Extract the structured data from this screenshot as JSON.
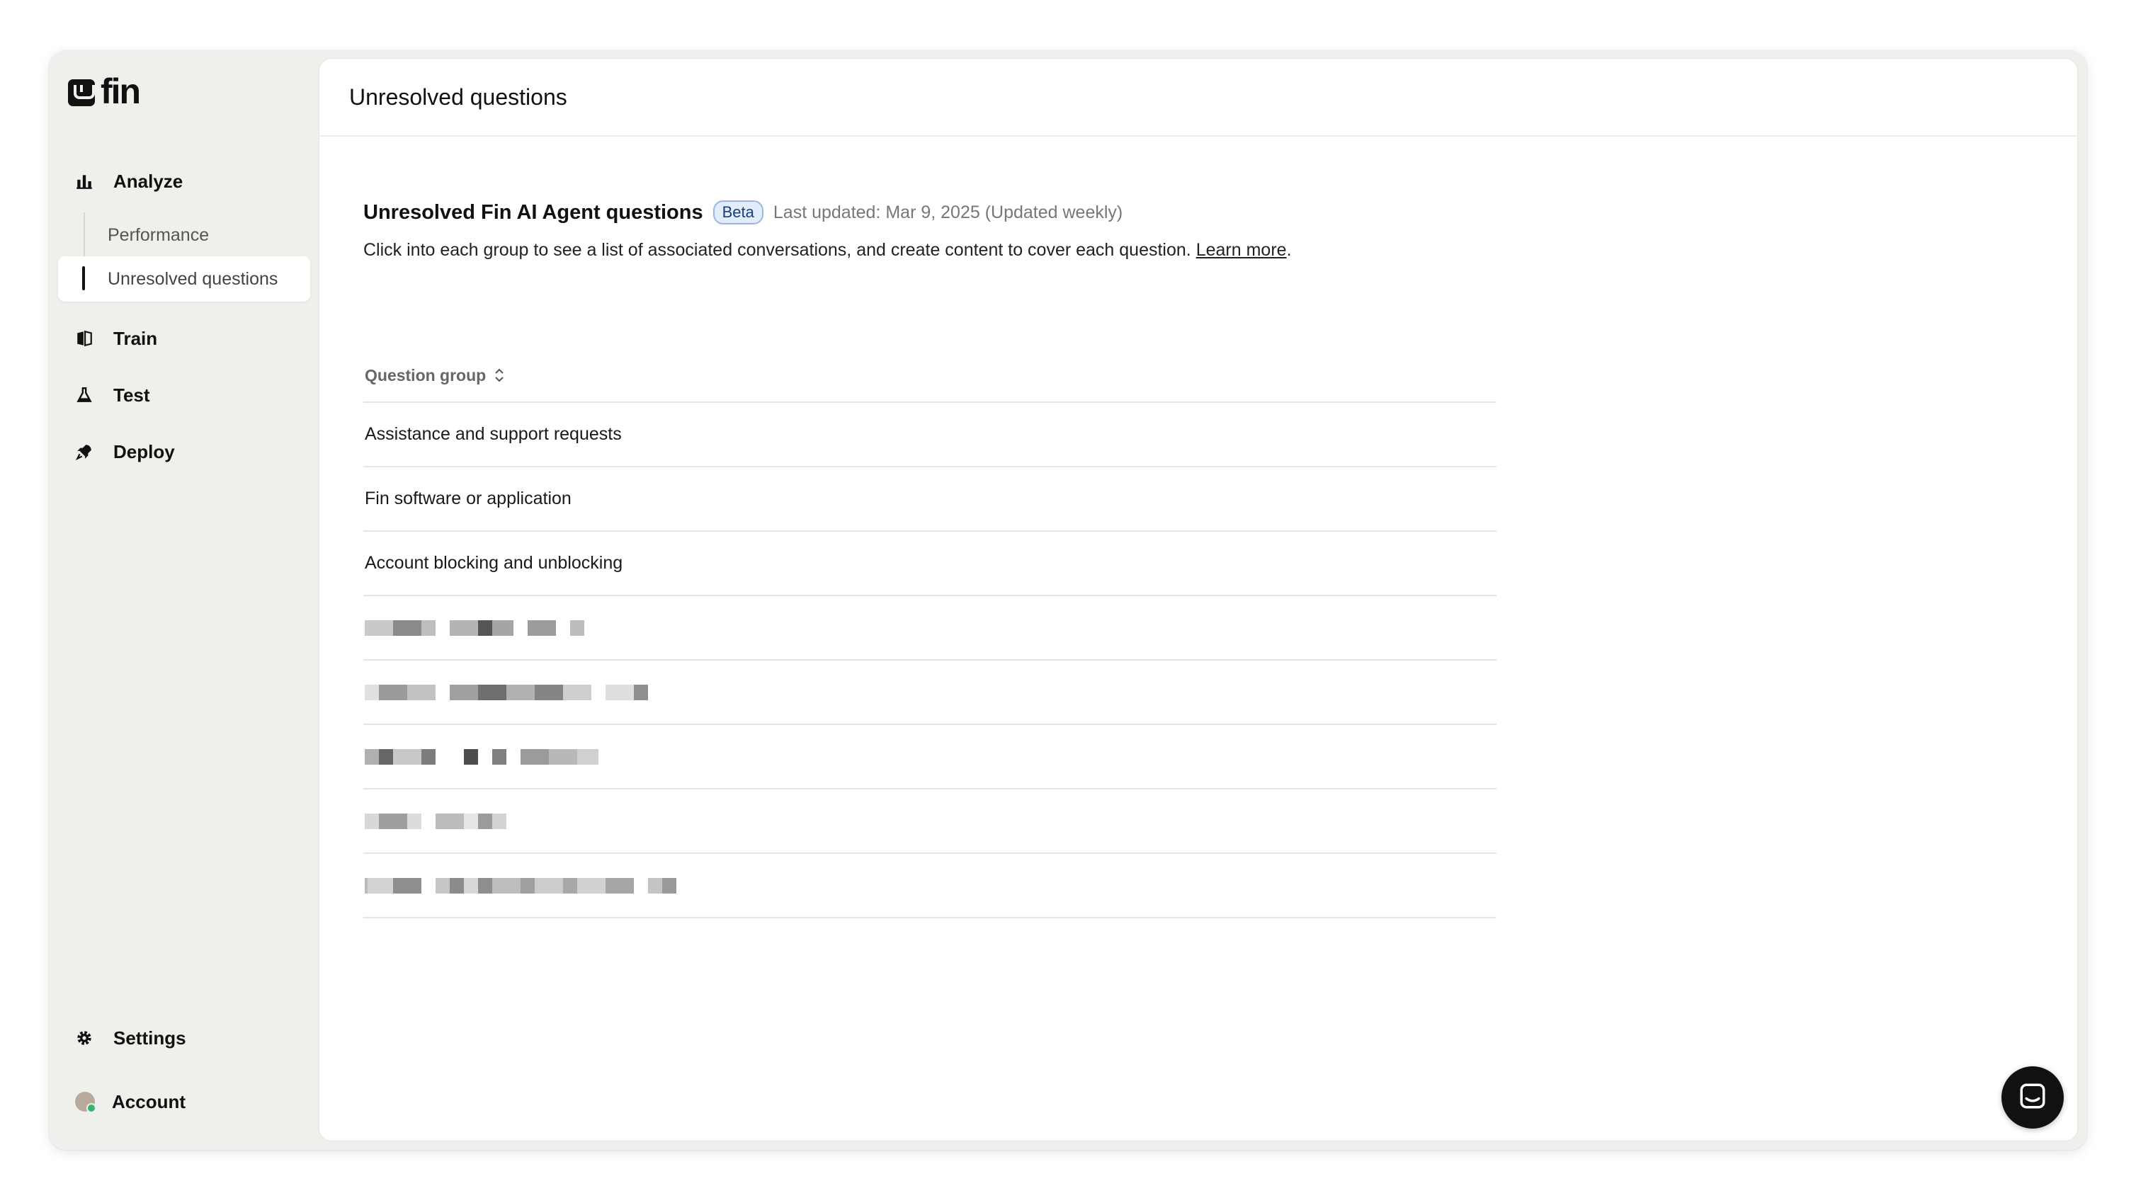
{
  "app": {
    "logo_text": "fin"
  },
  "sidebar": {
    "nav": [
      {
        "label": "Analyze",
        "icon": "bar-chart-icon"
      },
      {
        "label": "Train",
        "icon": "book-icon"
      },
      {
        "label": "Test",
        "icon": "flask-icon"
      },
      {
        "label": "Deploy",
        "icon": "rocket-icon"
      }
    ],
    "analyze_sub": [
      {
        "label": "Performance"
      },
      {
        "label": "Unresolved questions",
        "active": true
      }
    ],
    "bottom": [
      {
        "label": "Settings",
        "icon": "gear-icon"
      },
      {
        "label": "Account",
        "icon": "avatar"
      }
    ]
  },
  "main": {
    "page_title": "Unresolved questions",
    "section": {
      "title": "Unresolved Fin AI Agent questions",
      "badge": "Beta",
      "updated": "Last updated: Mar 9, 2025 (Updated weekly)",
      "description": "Click into each group to see a list of associated conversations, and create content to cover each question.",
      "learn_more": "Learn more",
      "trailing": "."
    },
    "table": {
      "column": "Question group",
      "rows": [
        "Assistance and support requests",
        "Fin software or application",
        "Account blocking and unblocking"
      ],
      "redacted_rows": 5
    }
  },
  "colors": {
    "sidebar_bg": "#efefec",
    "panel_bg": "#ffffff",
    "badge_bg": "#e3ecfb",
    "badge_border": "#9db5e3",
    "launcher_bg": "#111111"
  }
}
